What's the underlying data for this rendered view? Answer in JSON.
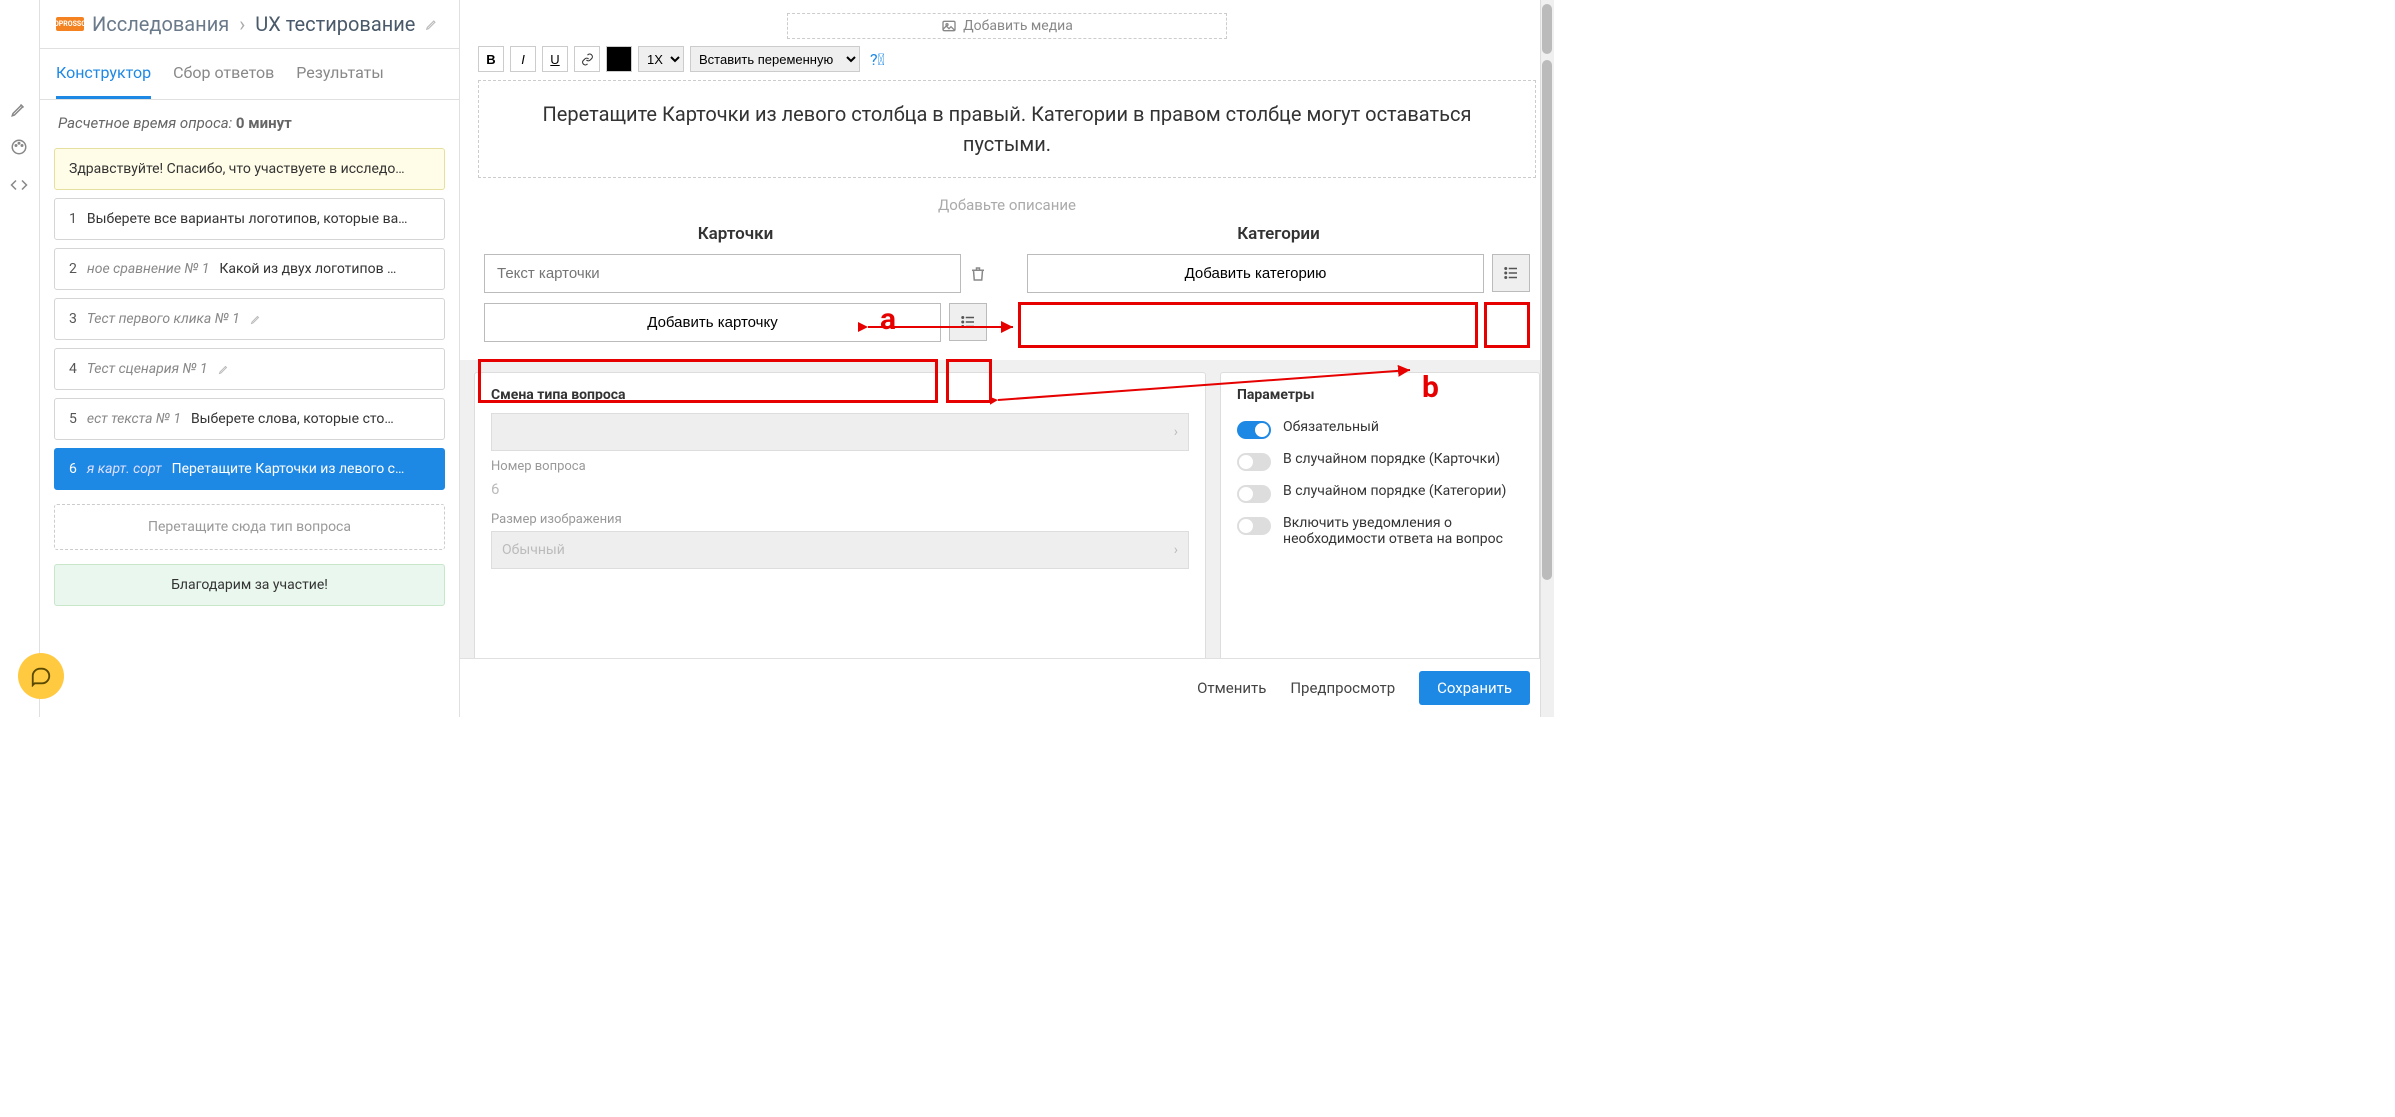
{
  "breadcrumb": {
    "root": "Исследования",
    "current": "UX тестирование"
  },
  "tabs": {
    "t1": "Конструктор",
    "t2": "Сбор ответов",
    "t3": "Результаты"
  },
  "estimate": {
    "label": "Расчетное время опроса:",
    "value": "0 минут"
  },
  "questions": {
    "intro": "Здравствуйте! Спасибо, что участвуете в исследо…",
    "items": [
      {
        "num": "1",
        "tag": "",
        "text": "Выберете все варианты логотипов, которые ва…"
      },
      {
        "num": "2",
        "tag": "ное сравнение № 1",
        "text": "Какой из двух логотипов …"
      },
      {
        "num": "3",
        "tag": "Тест первого клика № 1",
        "text": ""
      },
      {
        "num": "4",
        "tag": "Тест сценария № 1",
        "text": ""
      },
      {
        "num": "5",
        "tag": "ест текста № 1",
        "text": "Выберете слова, которые сто…"
      },
      {
        "num": "6",
        "tag": "я карт. сорт",
        "text": "Перетащите Карточки из левого с…"
      }
    ],
    "dropzone": "Перетащите сюда тип вопроса",
    "outro": "Благодарим за участие!"
  },
  "editor": {
    "add_media": "Добавить медиа",
    "rte": {
      "bold": "B",
      "italic": "I",
      "underline": "U",
      "size": "1X",
      "var_select": "Вставить переменную"
    },
    "title": "Перетащите Карточки из левого столбца в правый. Категории в правом столбце могут оставаться пустыми.",
    "desc_placeholder": "Добавьте описание",
    "cards": {
      "heading": "Карточки",
      "input_placeholder": "Текст карточки",
      "add_btn": "Добавить карточку"
    },
    "cats": {
      "heading": "Категории",
      "add_btn": "Добавить категорию"
    },
    "annot": {
      "a": "a",
      "b": "b"
    }
  },
  "qtype": {
    "heading": "Смена типа вопроса",
    "selected": "",
    "num_label": "Номер вопроса",
    "num_value": "6",
    "size_label": "Размер изображения",
    "size_value": "Обычный"
  },
  "params": {
    "heading": "Параметры",
    "p1": "Обязательный",
    "p2": "В случайном порядке (Карточки)",
    "p3": "В случайном порядке (Категории)",
    "p4": "Включить уведомления о необходимости ответа на вопрос"
  },
  "footer": {
    "cancel": "Отменить",
    "preview": "Предпросмотр",
    "save": "Сохранить"
  }
}
